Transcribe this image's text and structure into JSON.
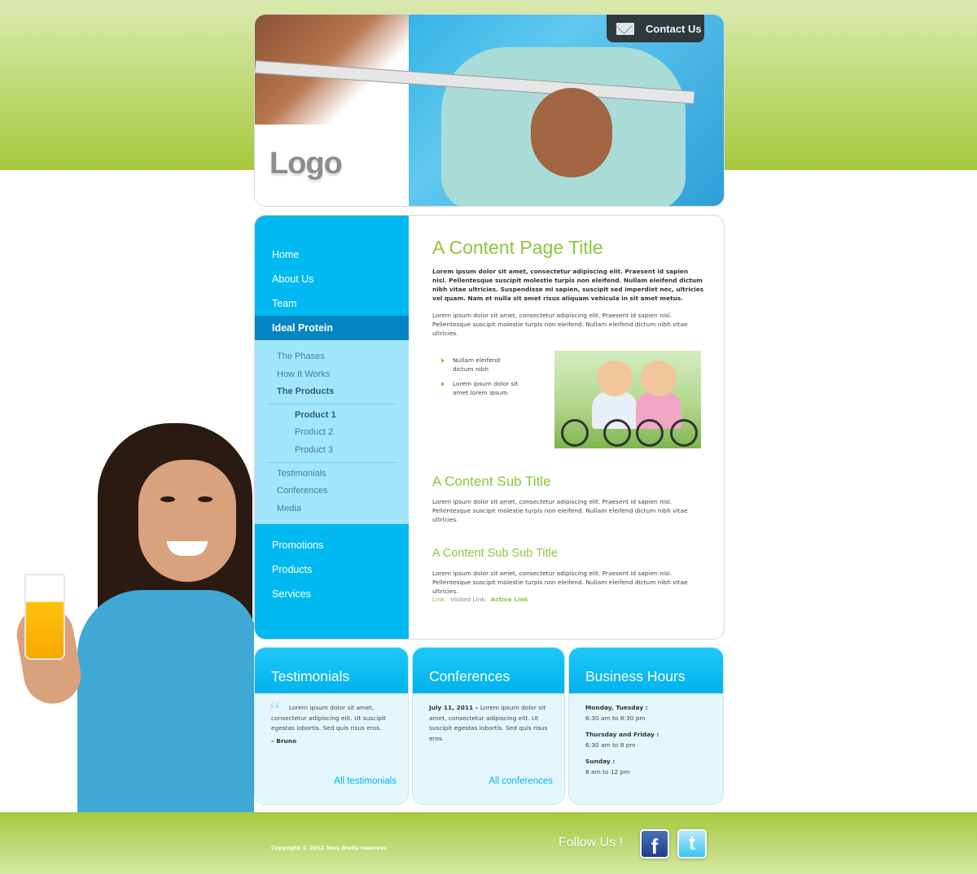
{
  "header": {
    "logo": "Logo",
    "contact_label": "Contact Us"
  },
  "sidebar": {
    "top": [
      {
        "label": "Home"
      },
      {
        "label": "About Us"
      },
      {
        "label": "Team"
      },
      {
        "label": "Ideal Protein"
      }
    ],
    "sub": [
      {
        "label": "The Phases"
      },
      {
        "label": "How It Works"
      },
      {
        "label": "The Products"
      }
    ],
    "products": [
      {
        "label": "Product 1"
      },
      {
        "label": "Product 2"
      },
      {
        "label": "Product 3"
      }
    ],
    "sub2": [
      {
        "label": "Testimonials"
      },
      {
        "label": "Conferences"
      },
      {
        "label": "Media"
      }
    ],
    "bottom": [
      {
        "label": "Promotions"
      },
      {
        "label": "Products"
      },
      {
        "label": "Services"
      }
    ]
  },
  "content": {
    "title": "A Content Page Title",
    "lead": "Lorem ipsum dolor sit amet, consectetur adipiscing elit. Praesent id sapien nisl. Pellentesque suscipit molestie turpis non eleifend. Nullam eleifend dictum nibh vitae ultricies. Suspendisse mi sapien, suscipit sed imperdiet nec, ultricies vel quam. Nam et nulla sit amet risus aliquam vehicula in sit amet metus.",
    "para1": "Lorem ipsum dolor sit amet, consectetur adipiscing elit. Praesent id sapien nisl. Pellentesque suscipit molestie turpis non eleifend. Nullam eleifend dictum nibh vitae ultricies.",
    "bullets": [
      "Nullam eleifend dictum nibh",
      "Lorem ipsum dolor sit amet lorem ipsum"
    ],
    "subtitle": "A Content Sub Title",
    "para2": "Lorem ipsum dolor sit amet, consectetur adipiscing elit. Praesent id sapien nisl. Pellentesque suscipit molestie turpis non eleifend. Nullam eleifend dictum nibh vitae ultricies.",
    "subsubtitle": "A Content Sub Sub Title",
    "para3": "Lorem ipsum dolor sit amet, consectetur adipiscing elit. Praesent id sapien nisl. Pellentesque suscipit molestie turpis non eleifend. Nullam eleifend dictum nibh vitae ultricies.",
    "links": {
      "link": "Link",
      "visited": "Visited Link",
      "active": "Active Link"
    }
  },
  "testimonials": {
    "title": "Testimonials",
    "quote": "Lorem ipsum dolor sit amet, consectetur adipiscing elit. Ut suscipit egestas lobortis. Sed quis risus eros.",
    "author": "– Bruno",
    "link": "All testimonials"
  },
  "conferences": {
    "title": "Conferences",
    "date": "July 11, 2011  –",
    "text": "Lorem ipsum dolor sit amet, consectetur adipiscing elit. Ut suscipit egestas lobortis. Sed quis risus eros.",
    "link": "All conferences"
  },
  "hours": {
    "title": "Business Hours",
    "items": [
      {
        "day": "Monday, Tuesday :",
        "time": "6:30 am to 8:30 pm"
      },
      {
        "day": "Thursday and Friday :",
        "time": "6:30 am to 8 pm"
      },
      {
        "day": "Sunday :",
        "time": "8 am to 12 pm"
      }
    ]
  },
  "footer": {
    "copyright": "Copyright © 2012 Tous droits réservés",
    "follow": "Follow Us !",
    "facebook_icon": "f",
    "twitter_icon": "t"
  },
  "colors": {
    "accent_green": "#8dc63f",
    "accent_blue": "#00b9f1",
    "nav_active": "#0385c3",
    "subnav_bg": "#a3e5fb"
  }
}
